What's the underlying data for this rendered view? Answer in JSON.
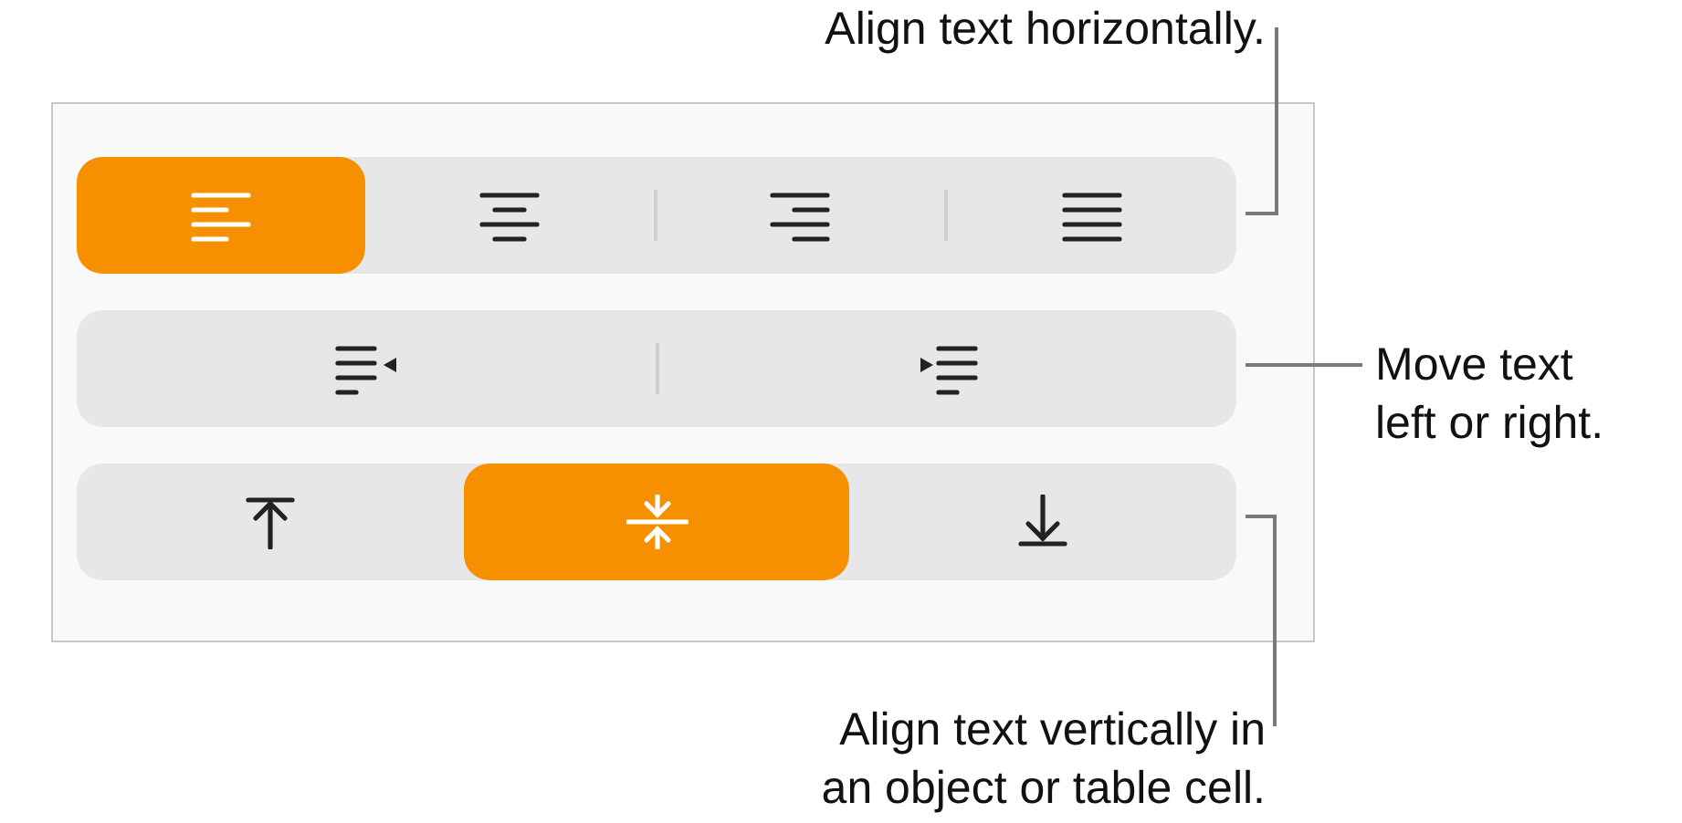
{
  "rows": [
    {
      "buttons": [
        {
          "selected": true
        },
        {
          "selected": false
        },
        {
          "selected": false
        },
        {
          "selected": false
        }
      ]
    },
    {
      "buttons": [
        {
          "selected": false
        },
        {
          "selected": false
        }
      ]
    },
    {
      "buttons": [
        {
          "selected": false
        },
        {
          "selected": true
        },
        {
          "selected": false
        }
      ]
    }
  ],
  "callouts": [
    {
      "lines": [
        "Align text horizontally."
      ]
    },
    {
      "lines": [
        "Move text",
        "left or right."
      ]
    },
    {
      "lines": [
        "Align text vertically in",
        "an object or table cell."
      ]
    }
  ]
}
